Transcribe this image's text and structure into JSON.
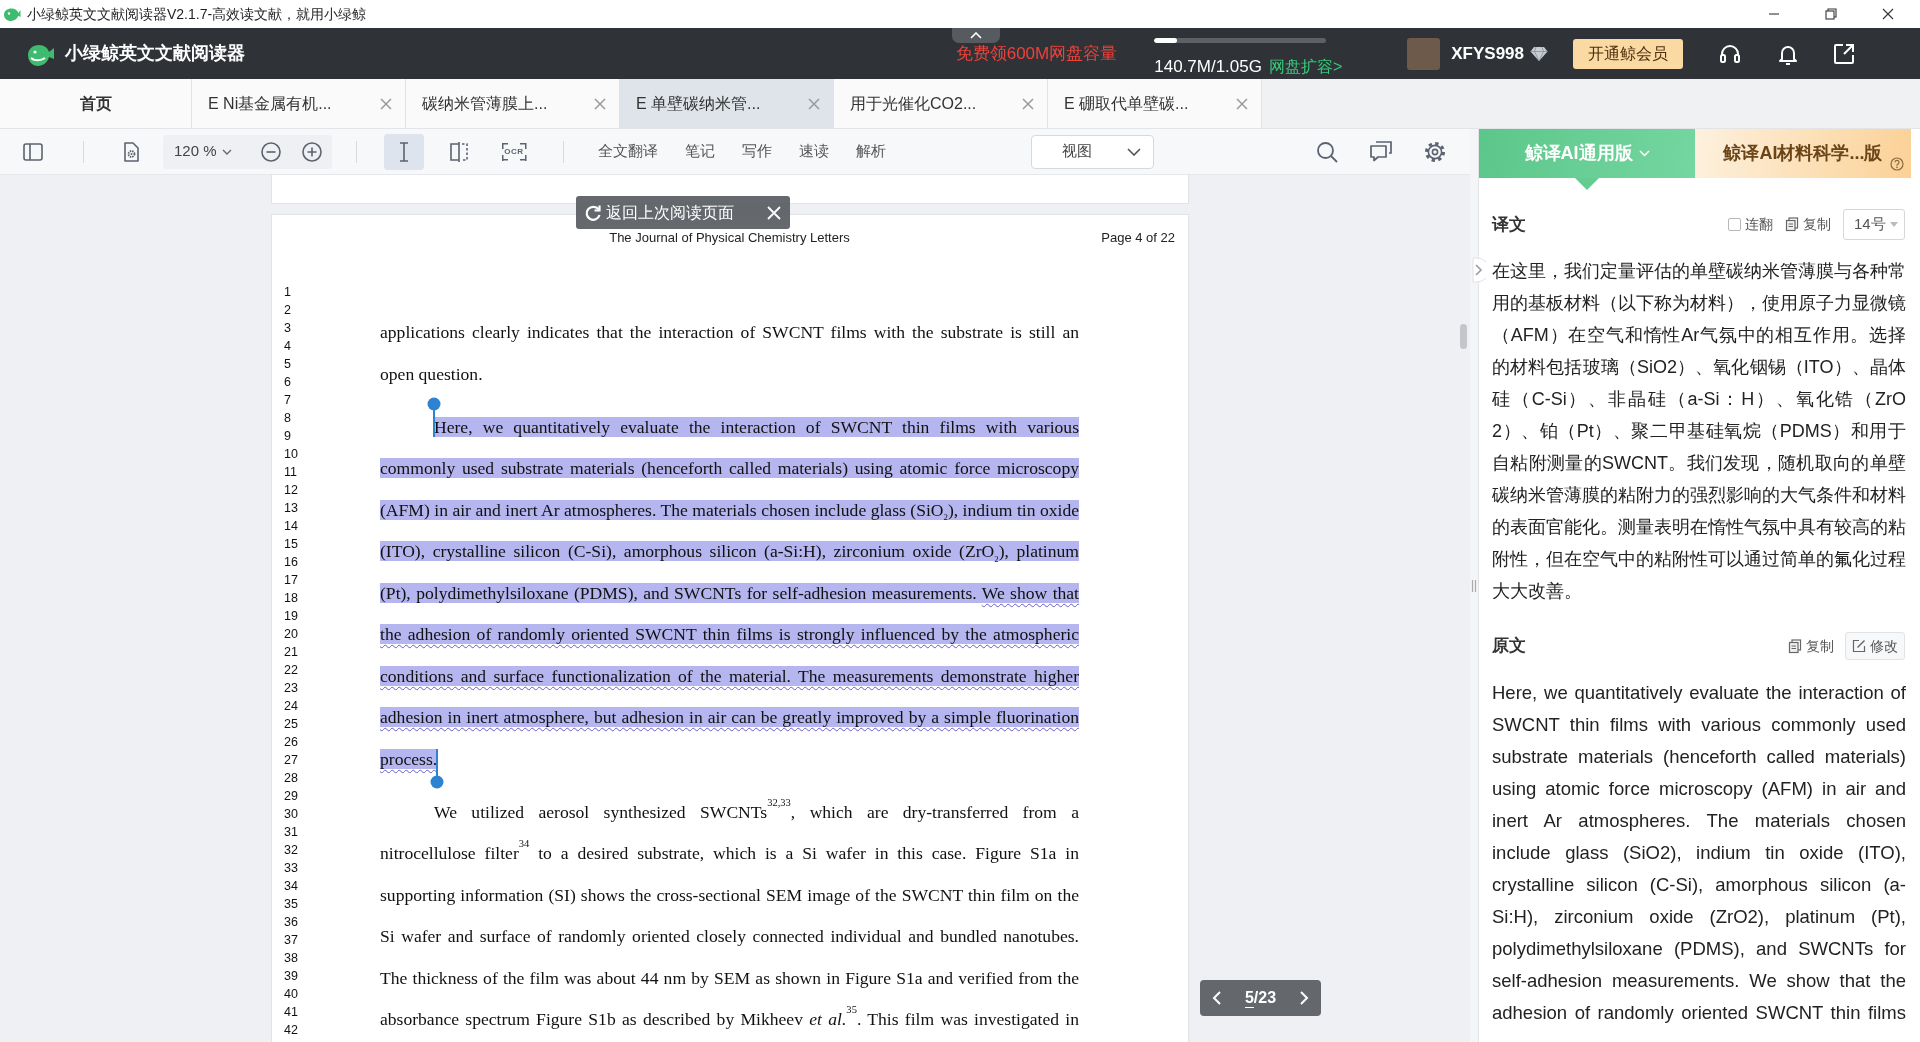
{
  "window": {
    "title": "小绿鲸英文文献阅读器V2.1.7-高效读文献，就用小绿鲸"
  },
  "header": {
    "app_name": "小绿鲸英文文献阅读器",
    "promo": "免费领600M网盘容量",
    "storage": {
      "level": 0.13,
      "usage": "140.7M/1.05G",
      "upgrade_link": "网盘扩容>"
    },
    "username": "XFYS998",
    "vip_button": "开通鲸会员"
  },
  "tabs": [
    {
      "label": "首页",
      "selected": false,
      "closable": false
    },
    {
      "label": "E Ni基金属有机...",
      "selected": false,
      "closable": true
    },
    {
      "label": "碳纳米管薄膜上...",
      "selected": false,
      "closable": true
    },
    {
      "label": "E 单壁碳纳米管...",
      "selected": true,
      "closable": true
    },
    {
      "label": "用于光催化CO2...",
      "selected": false,
      "closable": true
    },
    {
      "label": "E 硼取代单壁碳...",
      "selected": false,
      "closable": true
    }
  ],
  "toolbar": {
    "zoom": "120 %",
    "tools": [
      {
        "kind": "text-select",
        "selected": true
      },
      {
        "kind": "split-view",
        "selected": false
      },
      {
        "kind": "ocr",
        "label": "OCR",
        "selected": false
      }
    ],
    "actions": [
      "全文翻译",
      "笔记",
      "写作",
      "速读",
      "解析"
    ],
    "view_menu": "视图"
  },
  "return_popup": {
    "label": "返回上次阅读页面"
  },
  "page": {
    "journal": "The Journal of Physical Chemistry Letters",
    "page_label": "Page 4 of 22",
    "continues_on_next_page": true,
    "line_numbers": [
      "1",
      "2",
      "3",
      "4",
      "5",
      "6",
      "7",
      "8",
      "9",
      "10",
      "11",
      "12",
      "13",
      "14",
      "15",
      "16",
      "17",
      "18",
      "19",
      "20",
      "21",
      "22",
      "23",
      "24",
      "25",
      "26",
      "27",
      "28",
      "29",
      "30",
      "31",
      "32",
      "33",
      "34",
      "35",
      "36",
      "37",
      "38",
      "39",
      "40",
      "41",
      "42"
    ],
    "paragraphs": [
      {
        "indent": false,
        "highlighted": false,
        "segments": [
          {
            "text": "applications clearly indicates that the interaction of SWCNT films with the substrate is still an open question.",
            "wavy_underline": false
          }
        ]
      },
      {
        "indent": true,
        "highlighted": true,
        "segments": [
          {
            "text": "Here, we quantitatively evaluate the interaction of SWCNT thin films with various commonly used substrate materials (henceforth called materials) using atomic force microscopy (AFM) in air and inert Ar atmospheres. The materials chosen include glass (SiO$_{2}$), indium tin oxide (ITO), crystalline silicon (C-Si), amorphous silicon (a-Si:H), zirconium oxide (ZrO$_{2}$), platinum (Pt), polydimethylsiloxane (PDMS), and SWCNTs for self-adhesion measurements. ",
            "wavy_underline": false
          },
          {
            "text": "We show that the adhesion of randomly oriented SWCNT thin films is strongly influenced by the atmospheric conditions and surface functionalization of the material. The measurements demonstrate higher adhesion in inert atmosphere, but adhesion in air can be greatly improved by a simple fluorination process.",
            "wavy_underline": true
          }
        ]
      },
      {
        "indent": true,
        "highlighted": false,
        "segments": [
          {
            "text": "We utilized aerosol synthesized SWCNTs$^{32,33}$, which are dry-transferred from a nitrocellulose filter$^{34}$ to a desired substrate, which is a Si wafer in this case. Figure S1a in supporting information (SI) shows the cross-sectional SEM image of the SWCNT thin film on the Si wafer and surface of randomly oriented closely connected individual and bundled nanotubes. The thickness of the film was about 44 nm by SEM as shown in Figure S1a and verified from the absorbance spectrum Figure S1b as described by Mikheev *et al.*$^{35}$. This film was investigated in",
            "wavy_underline": false
          }
        ]
      }
    ]
  },
  "page_nav": {
    "current": "5",
    "total": "/23"
  },
  "translation_panel": {
    "engines": [
      {
        "kind": "general",
        "label": "鲸译AI通用版",
        "selected": true
      },
      {
        "kind": "specialist",
        "label": "鲸译AI材料科学...版",
        "selected": false
      }
    ],
    "translation": {
      "title": "译文",
      "continuous": {
        "label": "连翻",
        "checked": false
      },
      "copy": "复制",
      "font_size": "14号",
      "text": "在这里，我们定量评估的单壁碳纳米管薄膜与各种常用的基板材料（以下称为材料），使用原子力显微镜（AFM）在空气和惰性Ar气氛中的相互作用。选择的材料包括玻璃（SiO2）、氧化铟锡（ITO）、晶体硅（C-Si）、非晶硅（a-Si：H）、氧化锆（ZrO 2）、铂（Pt）、聚二甲基硅氧烷（PDMS）和用于自粘附测量的SWCNT。我们发现，随机取向的单壁碳纳米管薄膜的粘附力的强烈影响的大气条件和材料的表面官能化。测量表明在惰性气氛中具有较高的粘附性，但在空气中的粘附性可以通过简单的氟化过程大大改善。"
    },
    "source": {
      "title": "原文",
      "copy": "复制",
      "edit": "修改",
      "continues_below": true,
      "text": "Here, we quantitatively evaluate the interaction of SWCNT thin films with various commonly used substrate materials (henceforth called materials) using atomic force microscopy (AFM) in air and inert Ar atmospheres. The materials chosen include glass (SiO2), indium tin oxide (ITO), crystalline silicon (C-Si), amorphous silicon (a-Si:H), zirconium oxide (ZrO2), platinum (Pt), polydimethylsiloxane (PDMS), and SWCNTs for self-adhesion measurements. We show that the adhesion of randomly oriented SWCNT thin films"
    }
  }
}
